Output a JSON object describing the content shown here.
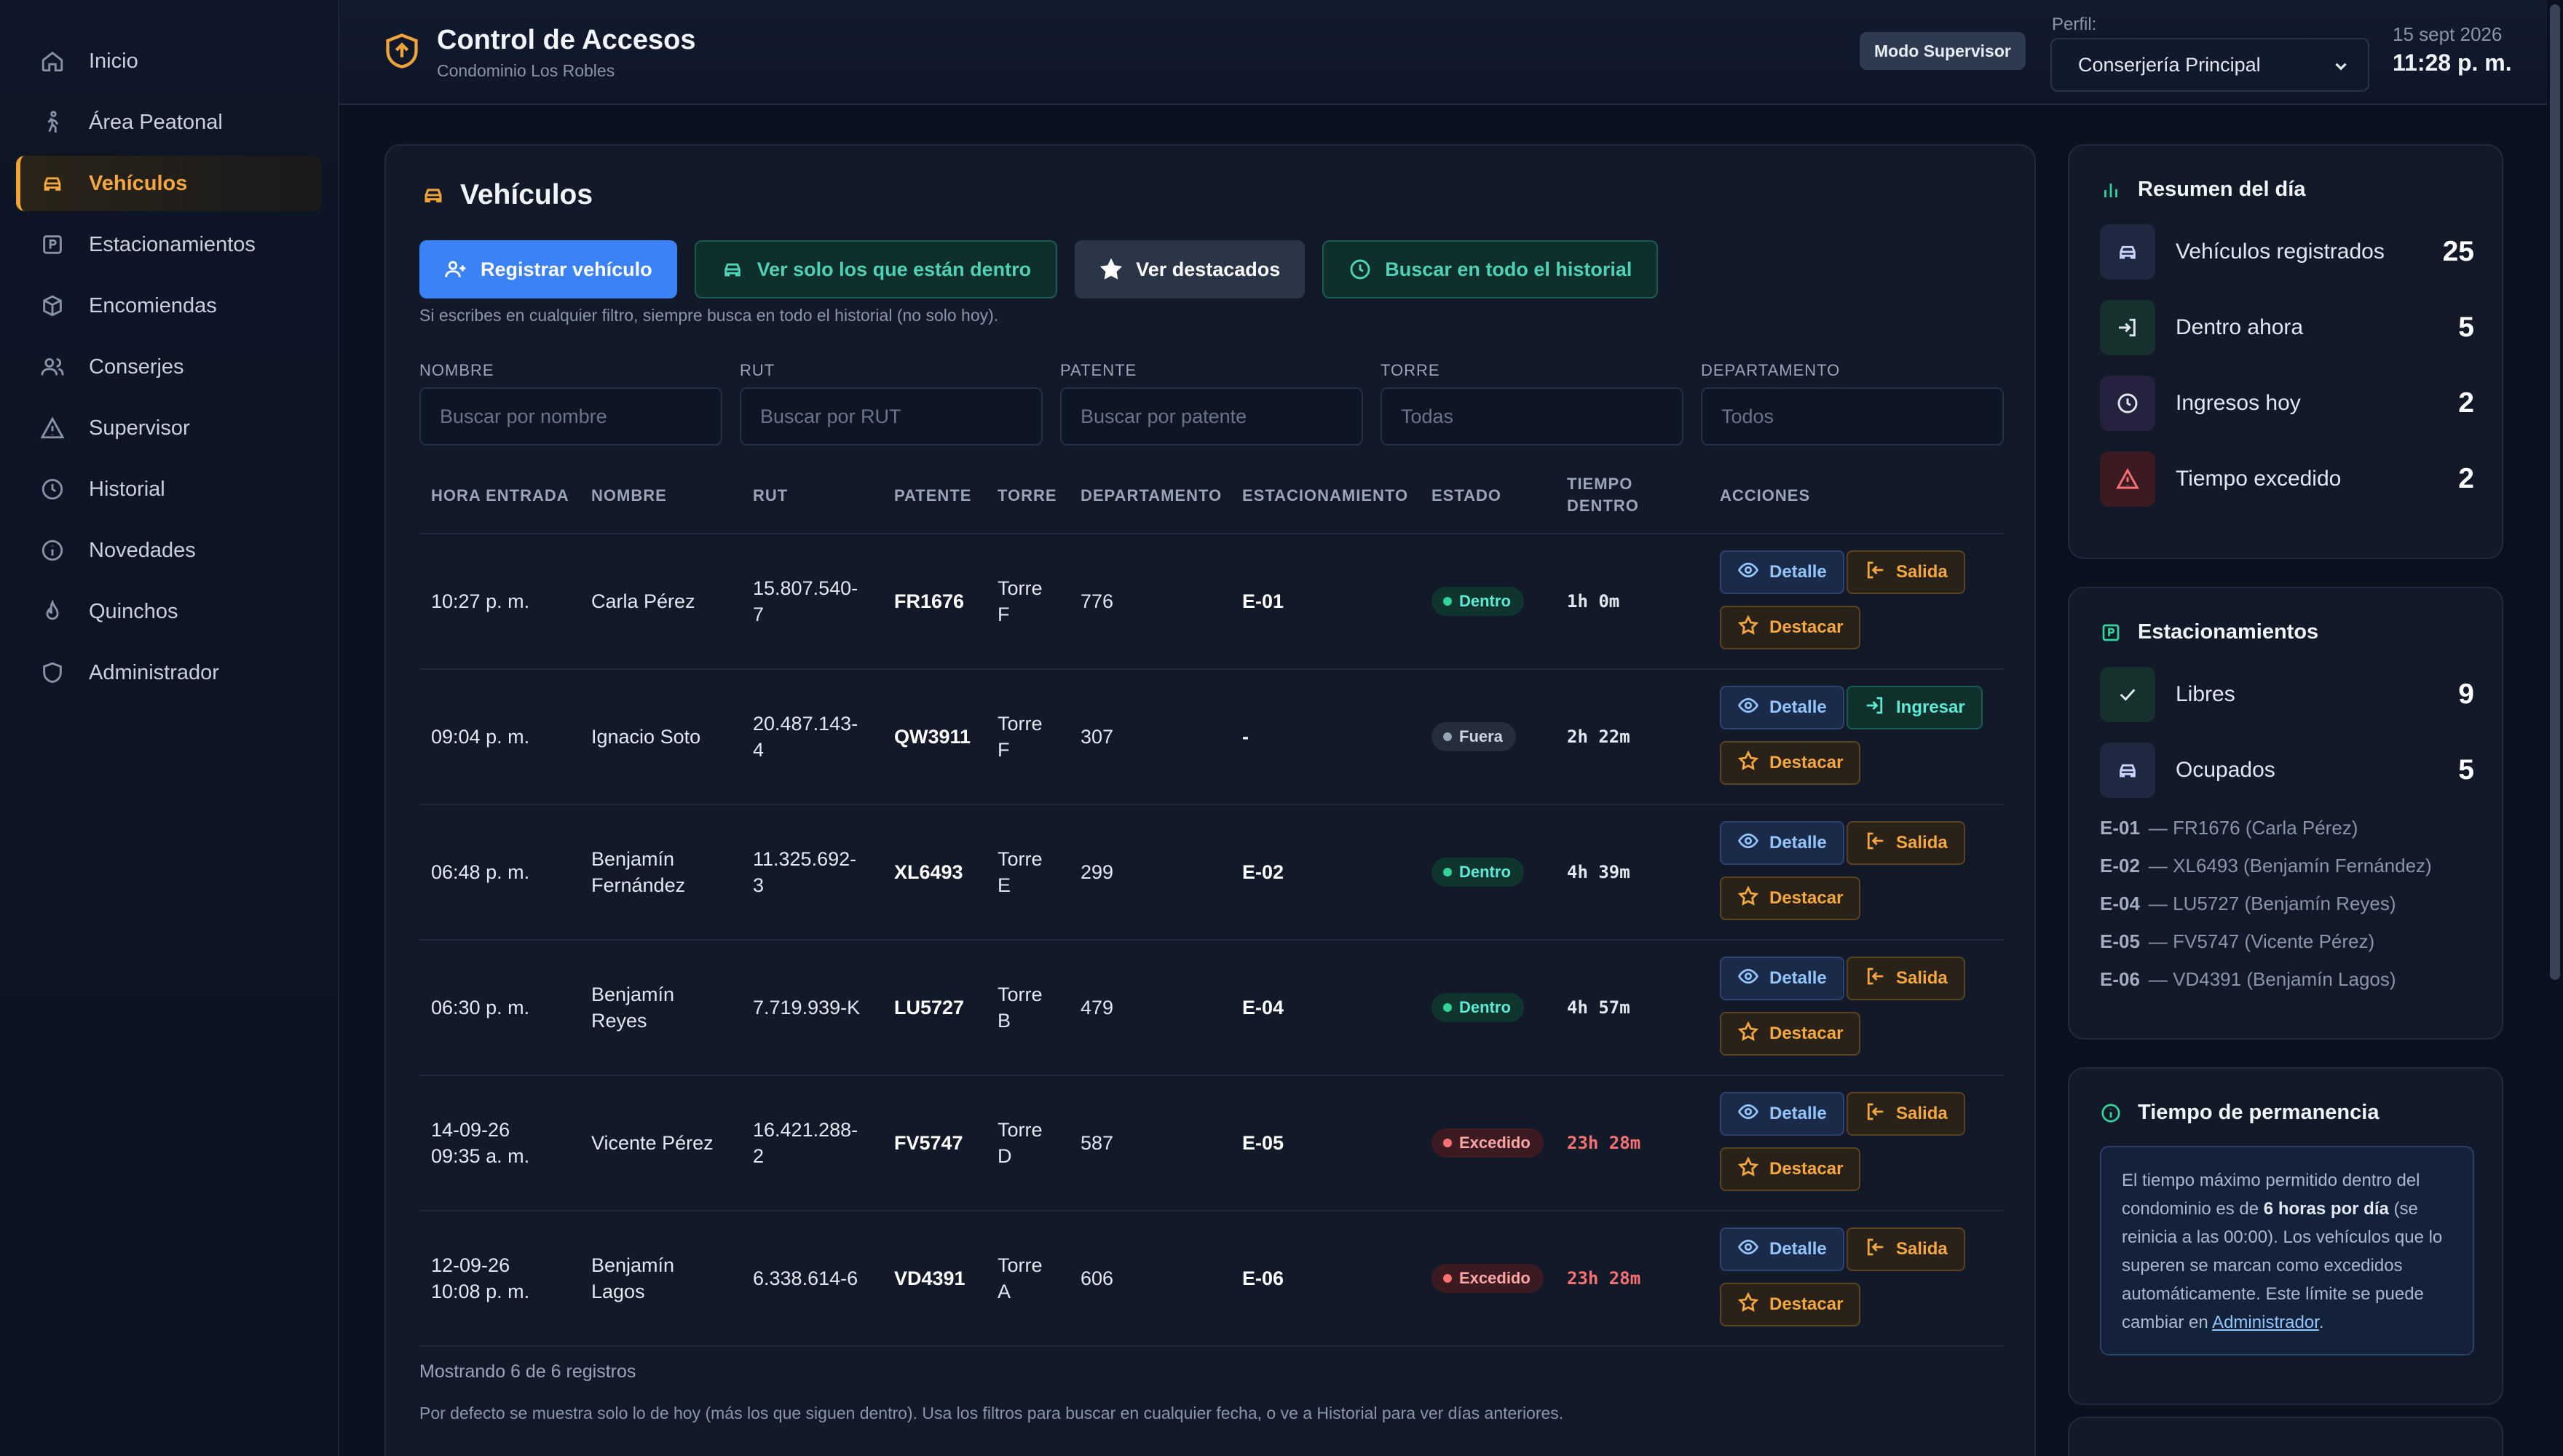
{
  "sidebar": {
    "items": [
      {
        "label": "Inicio",
        "icon": "home-icon"
      },
      {
        "label": "Área Peatonal",
        "icon": "walk-icon"
      },
      {
        "label": "Vehículos",
        "icon": "car-icon",
        "active": true
      },
      {
        "label": "Estacionamientos",
        "icon": "parking-icon"
      },
      {
        "label": "Encomiendas",
        "icon": "package-icon"
      },
      {
        "label": "Conserjes",
        "icon": "users-icon"
      },
      {
        "label": "Supervisor",
        "icon": "warning-icon"
      },
      {
        "label": "Historial",
        "icon": "clock-icon"
      },
      {
        "label": "Novedades",
        "icon": "info-icon"
      },
      {
        "label": "Quinchos",
        "icon": "flame-icon"
      },
      {
        "label": "Administrador",
        "icon": "shield-icon"
      }
    ]
  },
  "header": {
    "title": "Control de Accesos",
    "subtitle": "Condominio Los Robles",
    "mode_badge": "Modo Supervisor",
    "perfil_label": "Perfil:",
    "perfil_value": "Conserjería Principal",
    "date": "15 sept 2026",
    "time": "11:28 p. m."
  },
  "main": {
    "title": "Vehículos",
    "buttons": {
      "register": "Registrar vehículo",
      "inside_only": "Ver solo los que están dentro",
      "featured": "Ver destacados",
      "search_history": "Buscar en todo el historial"
    },
    "note": "Si escribes en cualquier filtro, siempre busca en todo el historial (no solo hoy).",
    "filters": [
      {
        "label": "NOMBRE",
        "placeholder": "Buscar por nombre"
      },
      {
        "label": "RUT",
        "placeholder": "Buscar por RUT"
      },
      {
        "label": "PATENTE",
        "placeholder": "Buscar por patente"
      },
      {
        "label": "TORRE",
        "placeholder": "Todas"
      },
      {
        "label": "DEPARTAMENTO",
        "placeholder": "Todos"
      }
    ],
    "columns": {
      "hora": "HORA ENTRADA",
      "nombre": "NOMBRE",
      "rut": "RUT",
      "patente": "PATENTE",
      "torre": "TORRE",
      "depto": "DEPARTAMENTO",
      "estac": "ESTACIONAMIENTO",
      "estado": "ESTADO",
      "tiempo1": "TIEMPO",
      "tiempo2": "DENTRO",
      "acciones": "ACCIONES"
    },
    "action_labels": {
      "detalle": "Detalle",
      "salida": "Salida",
      "ingresar": "Ingresar",
      "destacar": "Destacar"
    },
    "rows": [
      {
        "hora1": "10:27 p. m.",
        "hora2": "",
        "nombre1": "Carla Pérez",
        "nombre2": "",
        "rut1": "15.807.540-",
        "rut2": "7",
        "patente": "FR1676",
        "torre1": "Torre",
        "torre2": "F",
        "depto": "776",
        "estac": "E-01",
        "estado": "Dentro",
        "status": "in",
        "tiempo": "1h 0m",
        "action": "salida"
      },
      {
        "hora1": "09:04 p. m.",
        "hora2": "",
        "nombre1": "Ignacio Soto",
        "nombre2": "",
        "rut1": "20.487.143-",
        "rut2": "4",
        "patente": "QW3911",
        "torre1": "Torre",
        "torre2": "F",
        "depto": "307",
        "estac": "-",
        "estado": "Fuera",
        "status": "out",
        "tiempo": "2h 22m",
        "action": "ingresar"
      },
      {
        "hora1": "06:48 p. m.",
        "hora2": "",
        "nombre1": "Benjamín",
        "nombre2": "Fernández",
        "rut1": "11.325.692-",
        "rut2": "3",
        "patente": "XL6493",
        "torre1": "Torre",
        "torre2": "E",
        "depto": "299",
        "estac": "E-02",
        "estado": "Dentro",
        "status": "in",
        "tiempo": "4h 39m",
        "action": "salida"
      },
      {
        "hora1": "06:30 p. m.",
        "hora2": "",
        "nombre1": "Benjamín",
        "nombre2": "Reyes",
        "rut1": "7.719.939-K",
        "rut2": "",
        "patente": "LU5727",
        "torre1": "Torre",
        "torre2": "B",
        "depto": "479",
        "estac": "E-04",
        "estado": "Dentro",
        "status": "in",
        "tiempo": "4h 57m",
        "action": "salida"
      },
      {
        "hora1": "14-09-26",
        "hora2": "09:35 a. m.",
        "nombre1": "Vicente Pérez",
        "nombre2": "",
        "rut1": "16.421.288-",
        "rut2": "2",
        "patente": "FV5747",
        "torre1": "Torre",
        "torre2": "D",
        "depto": "587",
        "estac": "E-05",
        "estado": "Excedido",
        "status": "ex",
        "tiempo": "23h 28m",
        "action": "salida"
      },
      {
        "hora1": "12-09-26",
        "hora2": "10:08 p. m.",
        "nombre1": "Benjamín",
        "nombre2": "Lagos",
        "rut1": "6.338.614-6",
        "rut2": "",
        "patente": "VD4391",
        "torre1": "Torre",
        "torre2": "A",
        "depto": "606",
        "estac": "E-06",
        "estado": "Excedido",
        "status": "ex",
        "tiempo": "23h 28m",
        "action": "salida"
      }
    ],
    "footer_count": "Mostrando 6 de 6 registros",
    "footer_note": "Por defecto se muestra solo lo de hoy (más los que siguen dentro). Usa los filtros para buscar en cualquier fecha, o ve a Historial para ver días anteriores."
  },
  "summary": {
    "title": "Resumen del día",
    "stats": [
      {
        "label": "Vehículos registrados",
        "value": "25"
      },
      {
        "label": "Dentro ahora",
        "value": "5"
      },
      {
        "label": "Ingresos hoy",
        "value": "2"
      },
      {
        "label": "Tiempo excedido",
        "value": "2"
      }
    ]
  },
  "parking": {
    "title": "Estacionamientos",
    "free_label": "Libres",
    "free_value": "9",
    "occupied_label": "Ocupados",
    "occupied_value": "5",
    "spots": [
      {
        "id": "E-01",
        "text": "— FR1676 (Carla Pérez)"
      },
      {
        "id": "E-02",
        "text": "— XL6493 (Benjamín Fernández)"
      },
      {
        "id": "E-04",
        "text": "— LU5727 (Benjamín Reyes)"
      },
      {
        "id": "E-05",
        "text": "— FV5747 (Vicente Pérez)"
      },
      {
        "id": "E-06",
        "text": "— VD4391 (Benjamín Lagos)"
      }
    ]
  },
  "stay": {
    "title": "Tiempo de permanencia",
    "text_a": "El tiempo máximo permitido dentro del condominio es de ",
    "text_bold": "6 horas por día",
    "text_b": " (se reinicia a las 00:00). Los vehículos que lo superen se marcan como excedidos automáticamente. Este límite se puede cambiar en ",
    "link": "Administrador",
    "text_c": "."
  },
  "colors": {
    "accent": "#f0a33a",
    "primary": "#3b82f6",
    "teal": "#4fd1b5",
    "danger": "#f87171",
    "background": "#0c1120"
  }
}
